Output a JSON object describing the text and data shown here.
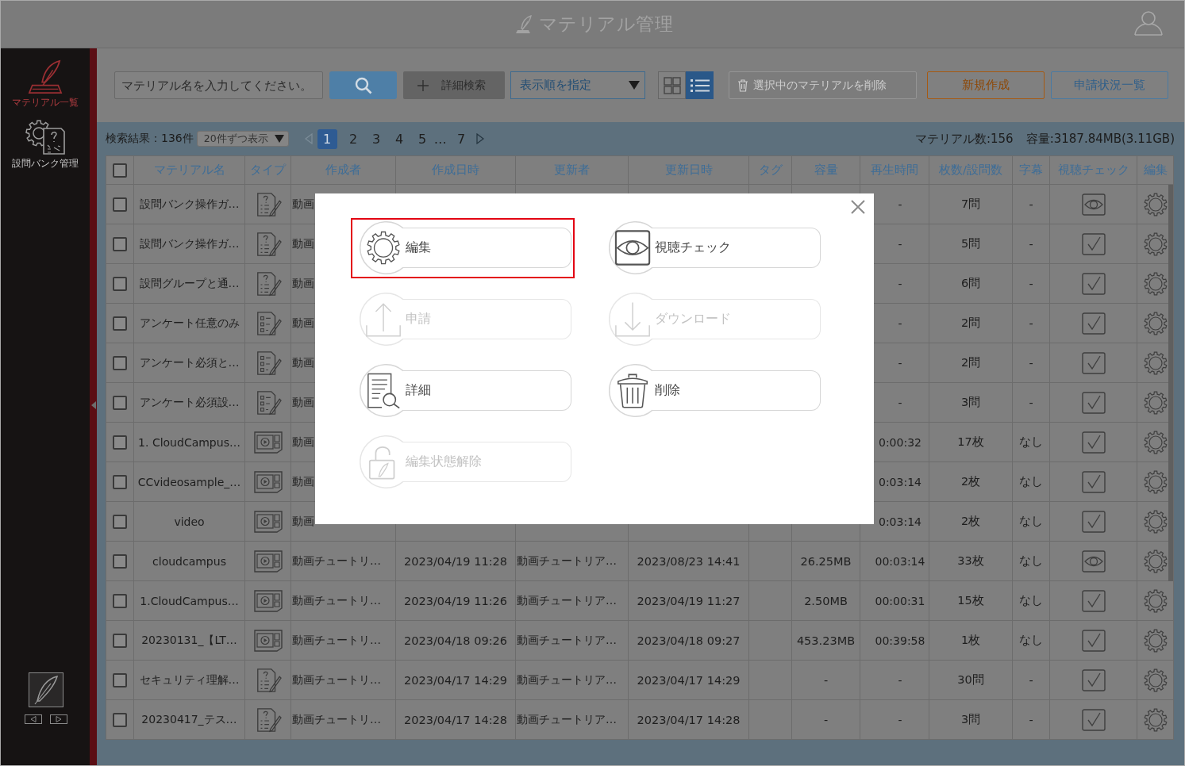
{
  "header": {
    "title": "マテリアル管理"
  },
  "sidebar": {
    "items": [
      {
        "label": "マテリアル一覧",
        "kind": "materials",
        "selected": true
      },
      {
        "label": "設問バンク管理",
        "kind": "question-bank",
        "selected": false
      }
    ]
  },
  "toolbar": {
    "search": {
      "placeholder": "マテリアル名を入力してください。"
    },
    "advanced_search": "詳細検索",
    "sort": "表示順を指定",
    "view_modes": [
      {
        "kind": "grid",
        "selected": false
      },
      {
        "kind": "list",
        "selected": true
      }
    ],
    "delete_selected": {
      "label": "選択中のマテリアルを削除",
      "disabled": true
    },
    "create": "新規作成",
    "application_status": "申請状況一覧"
  },
  "results": {
    "summary": "検索結果：136件",
    "per_page": "20件ずつ表示",
    "pagination": {
      "prev": {
        "disabled": true
      },
      "pages": [
        {
          "label": "1",
          "selected": true
        },
        {
          "label": "2",
          "selected": false
        },
        {
          "label": "3",
          "selected": false
        },
        {
          "label": "4",
          "selected": false
        },
        {
          "label": "5",
          "selected": false
        }
      ],
      "ellipsis": "…",
      "last": {
        "label": "7",
        "selected": false
      },
      "next": {
        "disabled": false
      }
    },
    "material_count": "マテリアル数:156",
    "capacity": "容量:3187.84MB(3.11GB)"
  },
  "table": {
    "select_all": {
      "checked": false
    },
    "columns": [
      "マテリアル名",
      "タイプ",
      "作成者",
      "作成日時",
      "更新者",
      "更新日時",
      "タグ",
      "容量",
      "再生時間",
      "枚数/設問数",
      "字幕",
      "視聴チェック",
      "編集"
    ],
    "rows": [
      {
        "checked": false,
        "name": "設問バンク操作ガ…",
        "type": {
          "kind": "quiz"
        },
        "creator": "動画",
        "duration": "-",
        "count": "7問",
        "subtitles": "-",
        "watch": {
          "kind": "eye"
        }
      },
      {
        "checked": false,
        "name": "設問バンク操作ガ…",
        "type": {
          "kind": "quiz"
        },
        "creator": "動画",
        "duration": "-",
        "count": "5問",
        "subtitles": "-",
        "watch": {
          "kind": "check"
        }
      },
      {
        "checked": false,
        "name": "設問グループと通…",
        "type": {
          "kind": "quiz"
        },
        "creator": "動画",
        "duration": "-",
        "count": "6問",
        "subtitles": "-",
        "watch": {
          "kind": "check"
        }
      },
      {
        "checked": false,
        "name": "アンケート任意のみ",
        "type": {
          "kind": "survey"
        },
        "creator": "動画",
        "duration": "-",
        "count": "2問",
        "subtitles": "-",
        "watch": {
          "kind": "check"
        }
      },
      {
        "checked": false,
        "name": "アンケート必須と…",
        "type": {
          "kind": "survey"
        },
        "creator": "動画",
        "duration": "-",
        "count": "2問",
        "subtitles": "-",
        "watch": {
          "kind": "check"
        }
      },
      {
        "checked": false,
        "name": "アンケート必須設…",
        "type": {
          "kind": "survey"
        },
        "creator": "動画",
        "duration": "-",
        "count": "3問",
        "subtitles": "-",
        "watch": {
          "kind": "check"
        }
      },
      {
        "checked": false,
        "name": "1. CloudCampus…",
        "type": {
          "kind": "video"
        },
        "creator": "動画",
        "duration": "0:00:32",
        "count": "17枚",
        "subtitles": "なし",
        "watch": {
          "kind": "check"
        }
      },
      {
        "checked": false,
        "name": "CCvideosample_…",
        "type": {
          "kind": "video"
        },
        "creator": "動画",
        "duration": "0:03:14",
        "count": "2枚",
        "subtitles": "なし",
        "watch": {
          "kind": "check"
        }
      },
      {
        "checked": false,
        "name": "video",
        "type": {
          "kind": "video"
        },
        "creator": "動画",
        "duration": "0:03:14",
        "count": "2枚",
        "subtitles": "なし",
        "watch": {
          "kind": "check"
        }
      },
      {
        "checked": false,
        "name": "cloudcampus",
        "type": {
          "kind": "video"
        },
        "creator": "動画チュートリ…",
        "created": "2023/04/19 11:28",
        "updater": "動画チュートリア…",
        "updated": "2023/08/23 14:41",
        "size": "26.25MB",
        "duration": "00:03:14",
        "count": "33枚",
        "subtitles": "なし",
        "watch": {
          "kind": "eye"
        }
      },
      {
        "checked": false,
        "name": "1.CloudCampus…",
        "type": {
          "kind": "video"
        },
        "creator": "動画チュートリ…",
        "created": "2023/04/19 11:26",
        "updater": "動画チュートリア…",
        "updated": "2023/04/19 11:27",
        "size": "2.50MB",
        "duration": "00:00:31",
        "count": "15枚",
        "subtitles": "なし",
        "watch": {
          "kind": "check"
        }
      },
      {
        "checked": false,
        "name": "20230131_【LT…",
        "type": {
          "kind": "video"
        },
        "creator": "動画チュートリ…",
        "created": "2023/04/18 09:26",
        "updater": "動画チュートリア…",
        "updated": "2023/04/18 09:27",
        "size": "453.23MB",
        "duration": "00:39:58",
        "count": "1枚",
        "subtitles": "なし",
        "watch": {
          "kind": "check"
        }
      },
      {
        "checked": false,
        "name": "セキュリティ理解…",
        "type": {
          "kind": "quiz"
        },
        "creator": "動画チュートリ…",
        "created": "2023/04/17 14:29",
        "updater": "動画チュートリア…",
        "updated": "2023/04/17 14:29",
        "size": "-",
        "duration": "-",
        "count": "30問",
        "subtitles": "-",
        "watch": {
          "kind": "check"
        }
      },
      {
        "checked": false,
        "name": "20230417_テス…",
        "type": {
          "kind": "quiz"
        },
        "creator": "動画チュートリ…",
        "created": "2023/04/17 14:28",
        "updater": "動画チュートリア…",
        "updated": "2023/04/17 14:28",
        "size": "-",
        "duration": "-",
        "count": "3問",
        "subtitles": "-",
        "watch": {
          "kind": "check"
        }
      }
    ]
  },
  "modal": {
    "actions": [
      {
        "label": "編集",
        "kind": "edit",
        "disabled": false,
        "highlighted": true
      },
      {
        "label": "視聴チェック",
        "kind": "watch-check",
        "disabled": false,
        "highlighted": false
      },
      {
        "label": "申請",
        "kind": "apply",
        "disabled": true,
        "highlighted": false
      },
      {
        "label": "ダウンロード",
        "kind": "download",
        "disabled": true,
        "highlighted": false
      },
      {
        "label": "詳細",
        "kind": "details",
        "disabled": false,
        "highlighted": false
      },
      {
        "label": "削除",
        "kind": "delete",
        "disabled": false,
        "highlighted": false
      },
      {
        "label": "編集状態解除",
        "kind": "unlock",
        "disabled": true,
        "highlighted": false
      }
    ]
  }
}
